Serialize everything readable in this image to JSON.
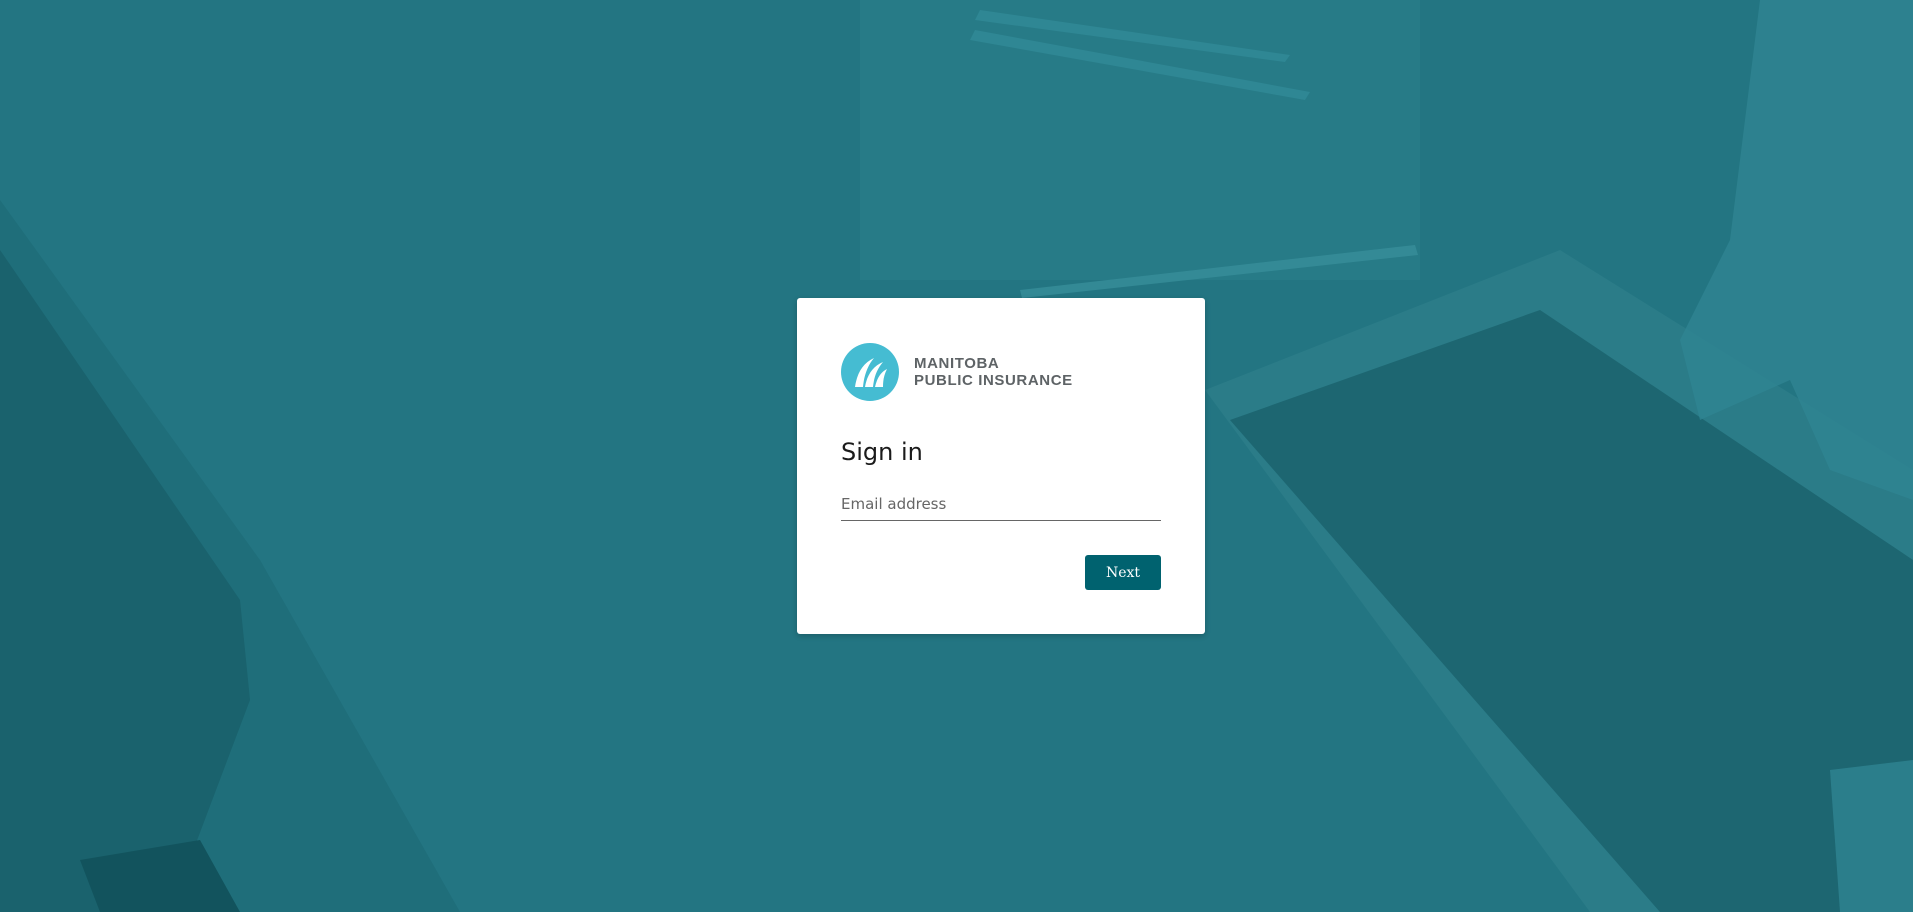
{
  "brand": {
    "line1": "MANITOBA",
    "line2": "PUBLIC INSURANCE",
    "logo_icon": "mpi-logo-icon",
    "logo_color": "#45bcd2"
  },
  "signin": {
    "title": "Sign in",
    "email_placeholder": "Email address",
    "email_value": "",
    "next_label": "Next"
  },
  "colors": {
    "background": "#237582",
    "button": "#00626f",
    "card": "#ffffff"
  }
}
